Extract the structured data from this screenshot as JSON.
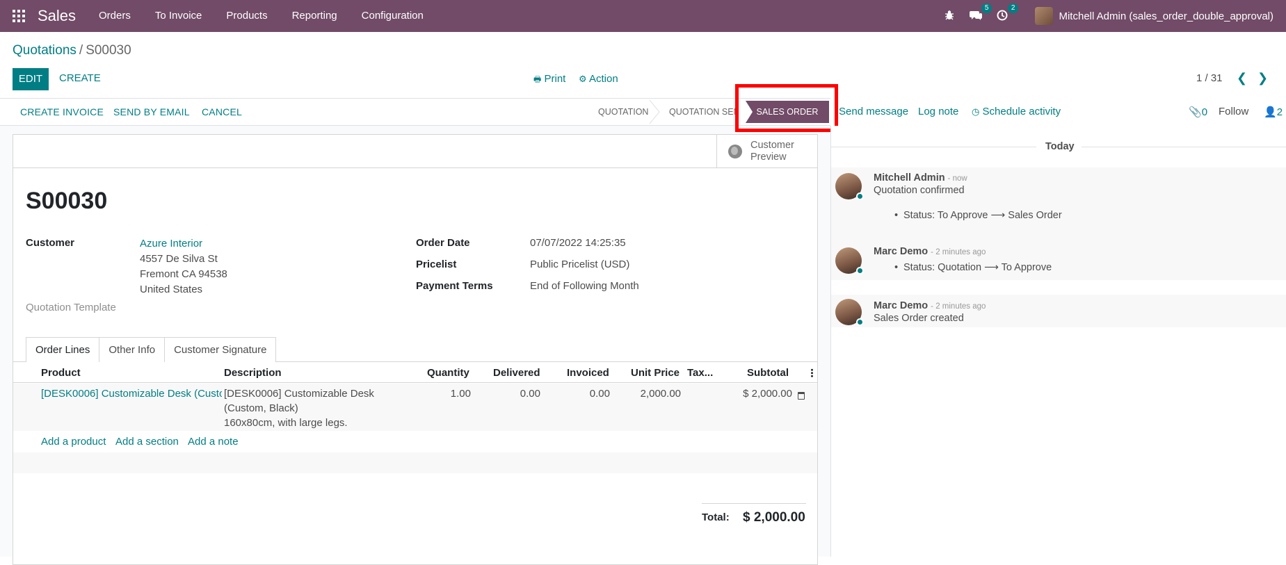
{
  "navbar": {
    "app_name": "Sales",
    "menu": [
      "Orders",
      "To Invoice",
      "Products",
      "Reporting",
      "Configuration"
    ],
    "messages_count": "5",
    "activities_count": "2",
    "user": "Mitchell Admin (sales_order_double_approval)"
  },
  "breadcrumb": {
    "parent": "Quotations",
    "separator": "/",
    "current": "S00030"
  },
  "controls": {
    "edit": "EDIT",
    "create": "CREATE",
    "print": "Print",
    "action": "Action",
    "pager": "1 / 31"
  },
  "statusbar": {
    "buttons": [
      "CREATE INVOICE",
      "SEND BY EMAIL",
      "CANCEL"
    ],
    "stages": [
      "QUOTATION",
      "QUOTATION SENT",
      "SALES ORDER"
    ],
    "active_stage": "SALES ORDER"
  },
  "chatter_header": {
    "send_message": "Send message",
    "log_note": "Log note",
    "schedule": "Schedule activity",
    "attachments": "0",
    "follow": "Follow",
    "followers": "2"
  },
  "form": {
    "customer_preview": [
      "Customer",
      "Preview"
    ],
    "name": "S00030",
    "customer_label": "Customer",
    "customer_name": "Azure Interior",
    "address": [
      "4557 De Silva St",
      "Fremont CA 94538",
      "United States"
    ],
    "template_label": "Quotation Template",
    "order_date_label": "Order Date",
    "order_date": "07/07/2022 14:25:35",
    "pricelist_label": "Pricelist",
    "pricelist": "Public Pricelist (USD)",
    "payment_terms_label": "Payment Terms",
    "payment_terms": "End of Following Month",
    "tabs": [
      "Order Lines",
      "Other Info",
      "Customer Signature"
    ]
  },
  "table": {
    "headers": [
      "Product",
      "Description",
      "Quantity",
      "Delivered",
      "Invoiced",
      "Unit Price",
      "Tax...",
      "Subtotal"
    ],
    "rows": [
      {
        "product": "[DESK0006] Customizable Desk (Custo...",
        "description": [
          "[DESK0006] Customizable Desk",
          "(Custom, Black)",
          "160x80cm, with large legs."
        ],
        "quantity": "1.00",
        "delivered": "0.00",
        "invoiced": "0.00",
        "unit_price": "2,000.00",
        "tax": "",
        "subtotal": "$ 2,000.00"
      }
    ],
    "add_links": [
      "Add a product",
      "Add a section",
      "Add a note"
    ],
    "total_label": "Total:",
    "total_value": "$ 2,000.00"
  },
  "chatter": {
    "date_separator": "Today",
    "messages": [
      {
        "author": "Mitchell Admin",
        "date": "- now",
        "body": "Quotation confirmed",
        "tracking": "Status: To Approve ⟶ Sales Order"
      },
      {
        "author": "Marc Demo",
        "date": "- 2 minutes ago",
        "tracking": "Status: Quotation ⟶ To Approve"
      },
      {
        "author": "Marc Demo",
        "date": "- 2 minutes ago",
        "body": "Sales Order created"
      }
    ]
  },
  "colors": {
    "brand": "#714b67",
    "accent": "#017e84",
    "highlight": "#ff0000"
  }
}
